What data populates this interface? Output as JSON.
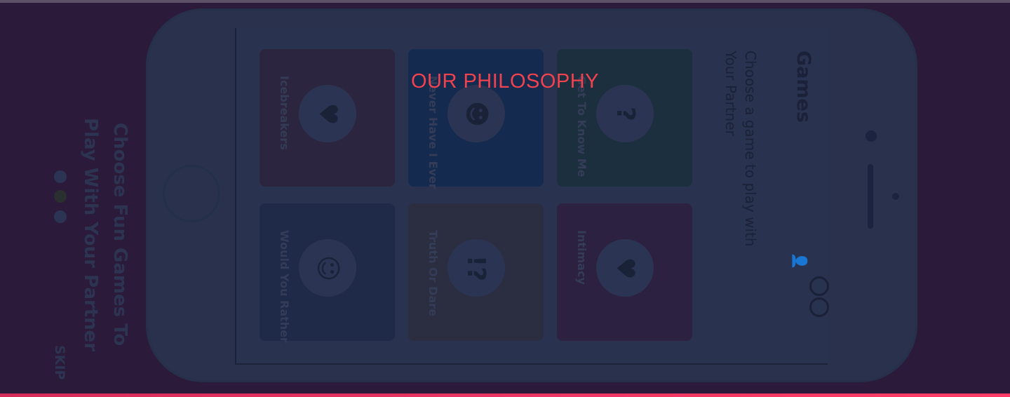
{
  "overlay_title": "OUR PHILOSOPHY",
  "onboarding": {
    "heading_line1": "Choose Fun Games To",
    "heading_line2": "Play With Your Partner",
    "skip_label": "SKIP",
    "page_dots": {
      "count": 3,
      "active_index": 1
    }
  },
  "app": {
    "title": "Games",
    "subtitle_line1": "Choose a game to play with",
    "subtitle_line2": "Your Partner",
    "games": [
      {
        "label": "Icebreakers",
        "icon": "teapot-icon",
        "color": "#2c2540"
      },
      {
        "label": "Never Have I Ever",
        "icon": "people-icon",
        "color": "#142a4e"
      },
      {
        "label": "Get To Know Me",
        "icon": "question-bubble-icon",
        "color": "#1b2f3e"
      },
      {
        "label": "Would You Rather",
        "icon": "thinking-face-icon",
        "color": "#1e2a48"
      },
      {
        "label": "Truth Or Dare",
        "icon": "exclamation-question-icon",
        "color": "#2b2e40"
      },
      {
        "label": "Intimacy",
        "icon": "heart-icon",
        "color": "#2c2140"
      }
    ]
  },
  "colors": {
    "accent": "#f0424f",
    "background": "#2c1a3b"
  }
}
